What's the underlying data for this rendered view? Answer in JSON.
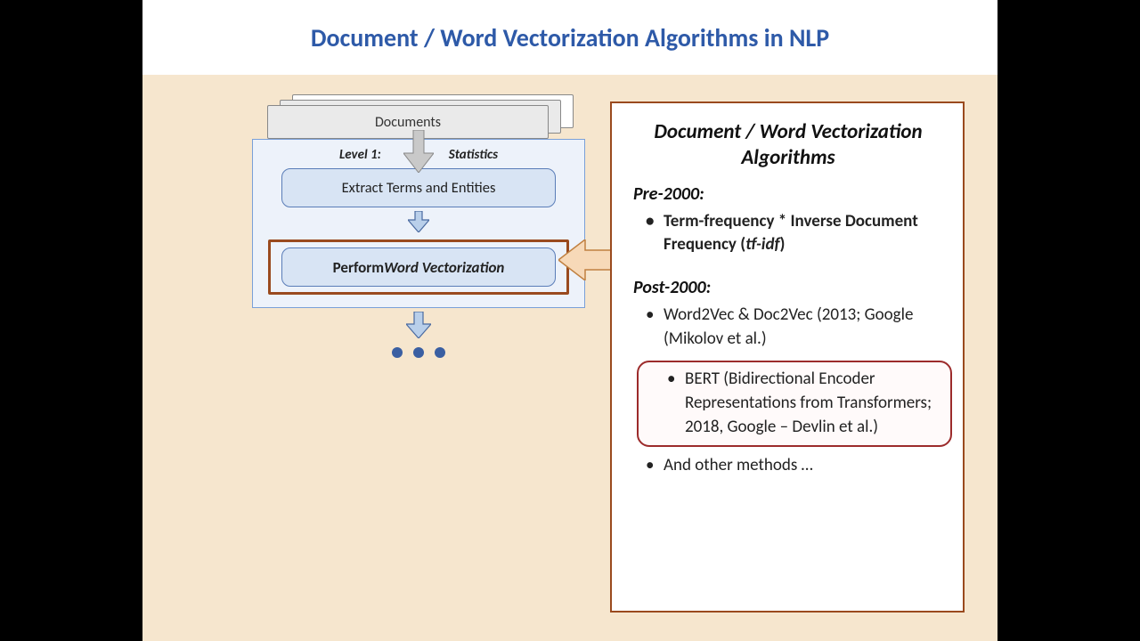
{
  "title": "Document / Word Vectorization Algorithms in NLP",
  "flow": {
    "documents_label": "Documents",
    "level_left": "Level  1:",
    "level_right": "Statistics",
    "step1": "Extract  Terms and Entities",
    "step2_prefix": "Perform ",
    "step2_em": "Word Vectorization"
  },
  "panel": {
    "heading": "Document / Word Vectorization Algorithms",
    "pre_label": "Pre-2000:",
    "pre_item_a": "Term-frequency * Inverse Document Frequency (",
    "pre_item_b": "tf-idf",
    "pre_item_c": ")",
    "post_label": "Post-2000:",
    "post_item_1": "Word2Vec & Doc2Vec (2013; Google (Mikolov et al.)",
    "post_item_2": "BERT (Bidirectional Encoder Representations from Transformers; 2018, Google – Devlin et al.)",
    "post_item_3": "And other methods …"
  }
}
